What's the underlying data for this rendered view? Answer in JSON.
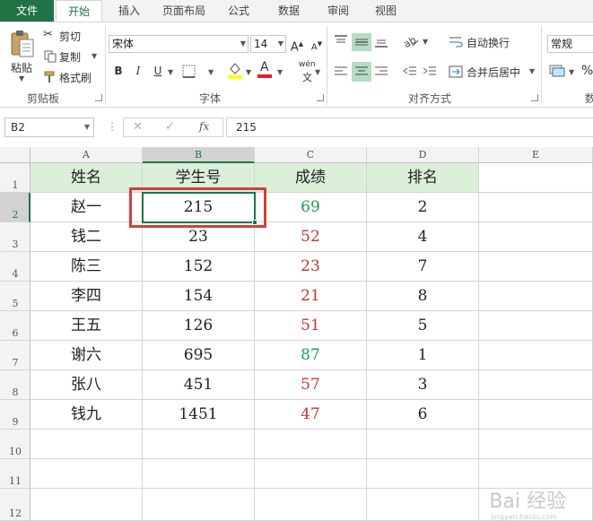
{
  "tabs": [
    {
      "label": "文件"
    },
    {
      "label": "开始"
    },
    {
      "label": "插入"
    },
    {
      "label": "页面布局"
    },
    {
      "label": "公式"
    },
    {
      "label": "数据"
    },
    {
      "label": "审阅"
    },
    {
      "label": "视图"
    }
  ],
  "ribbon": {
    "clipboard": {
      "paste": "粘贴",
      "cut": "剪切",
      "copy": "复制",
      "format_painter": "格式刷",
      "label": "剪贴板"
    },
    "font": {
      "name": "宋体",
      "size": "14",
      "bold": "B",
      "italic": "I",
      "underline": "U",
      "grow": "A",
      "shrink": "A",
      "pinyin": "wén",
      "label": "字体"
    },
    "alignment": {
      "wrap_text": "自动换行",
      "merge_center": "合并后居中",
      "label": "对齐方式"
    },
    "number": {
      "format": "常规",
      "percent": "%"
    }
  },
  "formula_bar": {
    "name_box": "B2",
    "cancel": "✕",
    "enter": "✓",
    "fx": "fx",
    "value": "215"
  },
  "sheet": {
    "columns": [
      "A",
      "B",
      "C",
      "D",
      "E"
    ],
    "rows": [
      "1",
      "2",
      "3",
      "4",
      "5",
      "6",
      "7",
      "8",
      "9",
      "10",
      "11",
      "12"
    ],
    "header": [
      "姓名",
      "学生号",
      "成绩",
      "排名"
    ],
    "data": [
      [
        "赵一",
        "215",
        "69",
        "2"
      ],
      [
        "钱二",
        "23",
        "52",
        "4"
      ],
      [
        "陈三",
        "152",
        "23",
        "7"
      ],
      [
        "李四",
        "154",
        "21",
        "8"
      ],
      [
        "王五",
        "126",
        "51",
        "5"
      ],
      [
        "谢六",
        "695",
        "87",
        "1"
      ],
      [
        "张八",
        "451",
        "57",
        "3"
      ],
      [
        "钱九",
        "1451",
        "47",
        "6"
      ]
    ],
    "score_colors": [
      "green",
      "red",
      "red",
      "red",
      "red",
      "green",
      "red",
      "red"
    ],
    "selected_cell": "B2"
  },
  "colors": {
    "accent": "#217346",
    "header_fill": "#dcefd9",
    "pass_color": "#1e9a52",
    "fail_color": "#c0392b",
    "annotation_box": "#d0413a"
  },
  "watermark": {
    "text": "Bai 经验",
    "sub": "jingyan.baidu.com"
  }
}
